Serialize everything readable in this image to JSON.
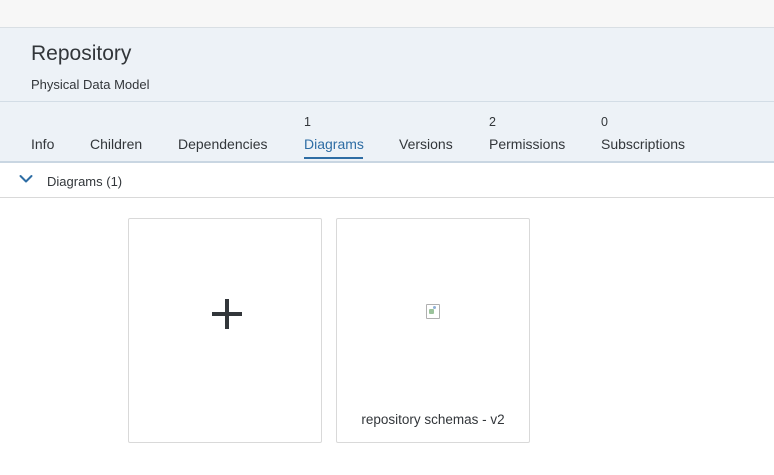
{
  "header": {
    "title": "Repository",
    "subtitle": "Physical Data Model"
  },
  "tabs": [
    {
      "label": "Info",
      "count": ""
    },
    {
      "label": "Children",
      "count": ""
    },
    {
      "label": "Dependencies",
      "count": ""
    },
    {
      "label": "Diagrams",
      "count": "1",
      "active": true
    },
    {
      "label": "Versions",
      "count": ""
    },
    {
      "label": "Permissions",
      "count": "2"
    },
    {
      "label": "Subscriptions",
      "count": "0"
    }
  ],
  "section": {
    "title": "Diagrams (1)",
    "expanded": true,
    "icon": "chevron-down-icon"
  },
  "cards": {
    "add": {
      "icon": "plus-icon"
    },
    "diagrams": [
      {
        "name": "repository schemas - v2",
        "icon": "diagram-thumbnail-icon"
      }
    ]
  },
  "colors": {
    "accent": "#2e6da4",
    "header_bg": "#edf2f7",
    "text": "#32363a"
  }
}
